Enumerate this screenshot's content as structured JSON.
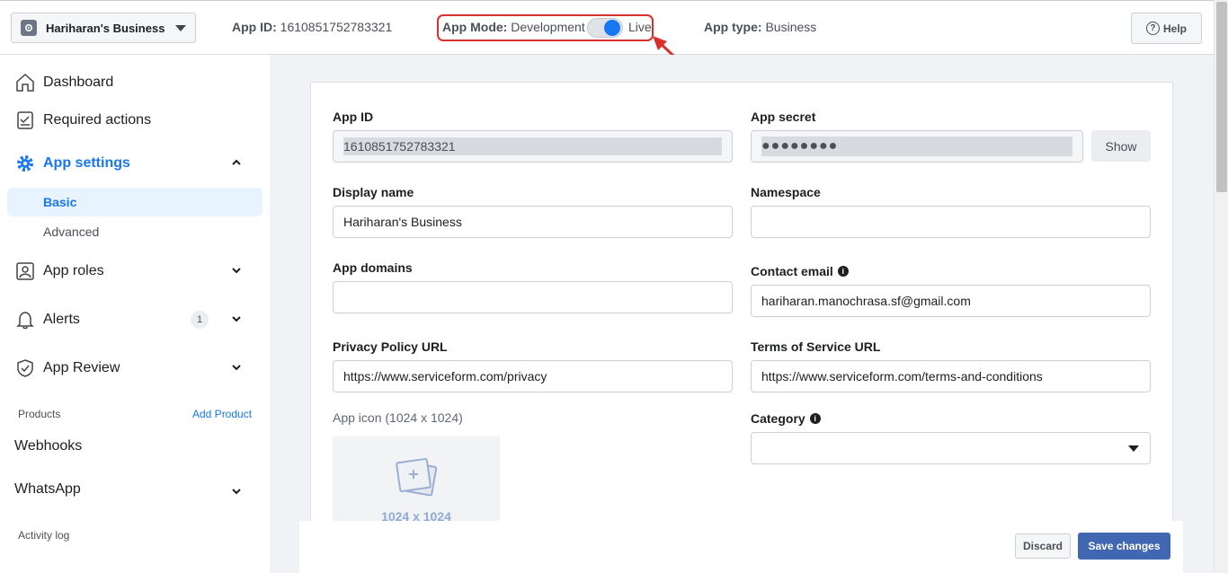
{
  "topbar": {
    "business_name": "Hariharan's Business",
    "app_id_label": "App ID:",
    "app_id_value": "1610851752783321",
    "mode_label": "App Mode:",
    "mode_value": "Development",
    "live_label": "Live",
    "app_type_label": "App type:",
    "app_type_value": "Business",
    "help_label": "Help",
    "mode_toggle_on": true
  },
  "sidebar": {
    "dashboard": "Dashboard",
    "required_actions": "Required actions",
    "app_settings": "App settings",
    "basic": "Basic",
    "advanced": "Advanced",
    "app_roles": "App roles",
    "alerts": "Alerts",
    "alerts_count": "1",
    "app_review": "App Review",
    "products_section": "Products",
    "add_product": "Add Product",
    "webhooks": "Webhooks",
    "whatsapp": "WhatsApp",
    "activity_log": "Activity log"
  },
  "form": {
    "app_id_label": "App ID",
    "app_id_value": "1610851752783321",
    "app_secret_label": "App secret",
    "app_secret_value": "●●●●●●●●",
    "show_label": "Show",
    "display_name_label": "Display name",
    "display_name_value": "Hariharan's Business",
    "namespace_label": "Namespace",
    "namespace_value": "",
    "app_domains_label": "App domains",
    "app_domains_value": "",
    "contact_email_label": "Contact email",
    "contact_email_value": "hariharan.manochrasa.sf@gmail.com",
    "privacy_label": "Privacy Policy URL",
    "privacy_value": "https://www.serviceform.com/privacy",
    "terms_label": "Terms of Service URL",
    "terms_value": "https://www.serviceform.com/terms-and-conditions",
    "app_icon_label": "App icon (1024 x 1024)",
    "app_icon_size": "1024 x 1024",
    "category_label": "Category",
    "category_value": ""
  },
  "footer": {
    "discard_label": "Discard",
    "save_label": "Save changes"
  },
  "colors": {
    "accent": "#1877f2",
    "save_button": "#4267b2",
    "highlight_box": "#d9302f"
  }
}
